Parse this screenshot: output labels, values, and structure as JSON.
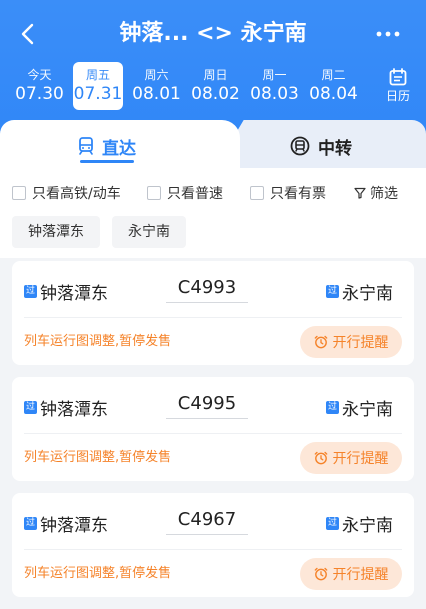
{
  "header": {
    "title": "钟落... <> 永宁南",
    "colors": {
      "primary": "#2f86f7",
      "accent_orange": "#f5832a"
    },
    "dates": [
      {
        "weekday": "今天",
        "date": "07.30",
        "active": false
      },
      {
        "weekday": "周五",
        "date": "07.31",
        "active": true
      },
      {
        "weekday": "周六",
        "date": "08.01",
        "active": false
      },
      {
        "weekday": "周日",
        "date": "08.02",
        "active": false
      },
      {
        "weekday": "周一",
        "date": "08.03",
        "active": false
      },
      {
        "weekday": "周二",
        "date": "08.04",
        "active": false
      }
    ],
    "calendar_label": "日历"
  },
  "tabs": {
    "direct": "直达",
    "transfer": "中转"
  },
  "filters": {
    "high_speed": "只看高铁/动车",
    "normal": "只看普速",
    "available": "只看有票",
    "filter": "筛选"
  },
  "station_chips": [
    "钟落潭东",
    "永宁南"
  ],
  "trains": [
    {
      "from": "钟落潭东",
      "to": "永宁南",
      "train_no": "C4993",
      "notice": "列车运行图调整,暂停发售",
      "remind": "开行提醒",
      "badge": "过"
    },
    {
      "from": "钟落潭东",
      "to": "永宁南",
      "train_no": "C4995",
      "notice": "列车运行图调整,暂停发售",
      "remind": "开行提醒",
      "badge": "过"
    },
    {
      "from": "钟落潭东",
      "to": "永宁南",
      "train_no": "C4967",
      "notice": "列车运行图调整,暂停发售",
      "remind": "开行提醒",
      "badge": "过"
    }
  ]
}
